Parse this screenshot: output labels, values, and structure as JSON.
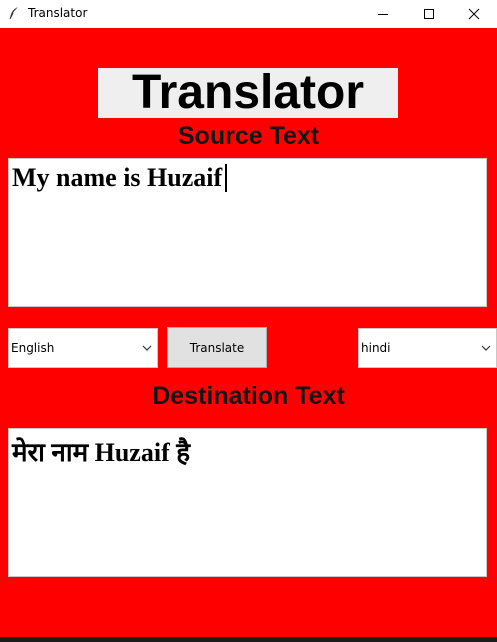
{
  "window": {
    "title": "Translator"
  },
  "app": {
    "heading": "Translator",
    "source_label": "Source Text",
    "destination_label": "Destination Text",
    "source_text": "My name is Huzaif",
    "destination_text": "मेरा नाम Huzaif है",
    "source_language": "English",
    "destination_language": "hindi",
    "translate_button": "Translate"
  },
  "colors": {
    "background": "#ff0000",
    "heading_bg": "#efefef"
  },
  "icons": {
    "app": "feather-icon",
    "minimize": "minimize-icon",
    "maximize": "maximize-icon",
    "close": "close-icon",
    "dropdown": "chevron-down-icon"
  }
}
